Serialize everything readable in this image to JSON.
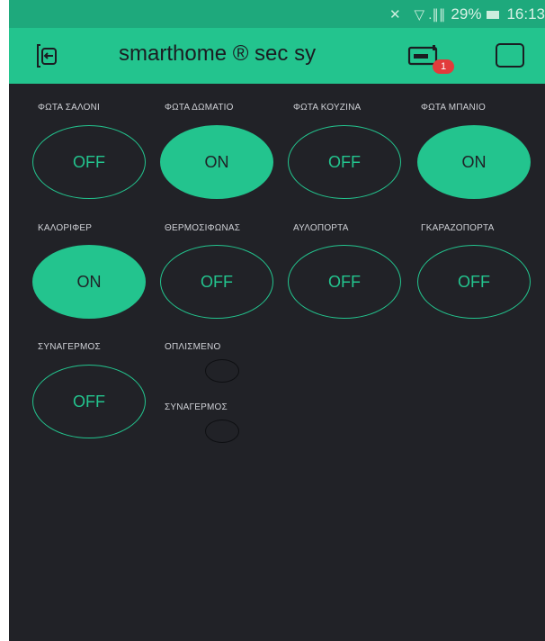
{
  "status_bar": {
    "signal_icons": "✕ ▽ .∥∥",
    "battery": "29%",
    "time": "16:13"
  },
  "app_bar": {
    "title": "smarthome ® sec sy",
    "notification_count": "1",
    "accent_color": "#23c48e",
    "badge_color": "#e23b3b"
  },
  "buttons": [
    {
      "label": "ΦΩΤΑ ΣΑΛΟΝΙ",
      "state": "OFF"
    },
    {
      "label": "ΦΩΤΑ ΔΩΜΑΤΙΟ",
      "state": "ON"
    },
    {
      "label": "ΦΩΤΑ ΚΟΥΖΙΝΑ",
      "state": "OFF"
    },
    {
      "label": "ΦΩΤΑ ΜΠΑΝΙΟ",
      "state": "ON"
    },
    {
      "label": "ΚΑΛΟΡΙΦΕΡ",
      "state": "ON"
    },
    {
      "label": "ΘΕΡΜΟΣΙΦΩΝΑΣ",
      "state": "OFF"
    },
    {
      "label": "ΑΥΛΟΠΟΡΤΑ",
      "state": "OFF"
    },
    {
      "label": "ΓΚΑΡΑΖΟΠΟΡΤΑ",
      "state": "OFF"
    },
    {
      "label": "ΣΥΝΑΓΕΡΜΟΣ",
      "state": "OFF"
    }
  ],
  "leds": [
    {
      "label": "ΟΠΛΙΣΜΕΝΟ",
      "lit": false
    },
    {
      "label": "ΣΥΝΑΓΕΡΜΟΣ",
      "lit": false
    }
  ]
}
